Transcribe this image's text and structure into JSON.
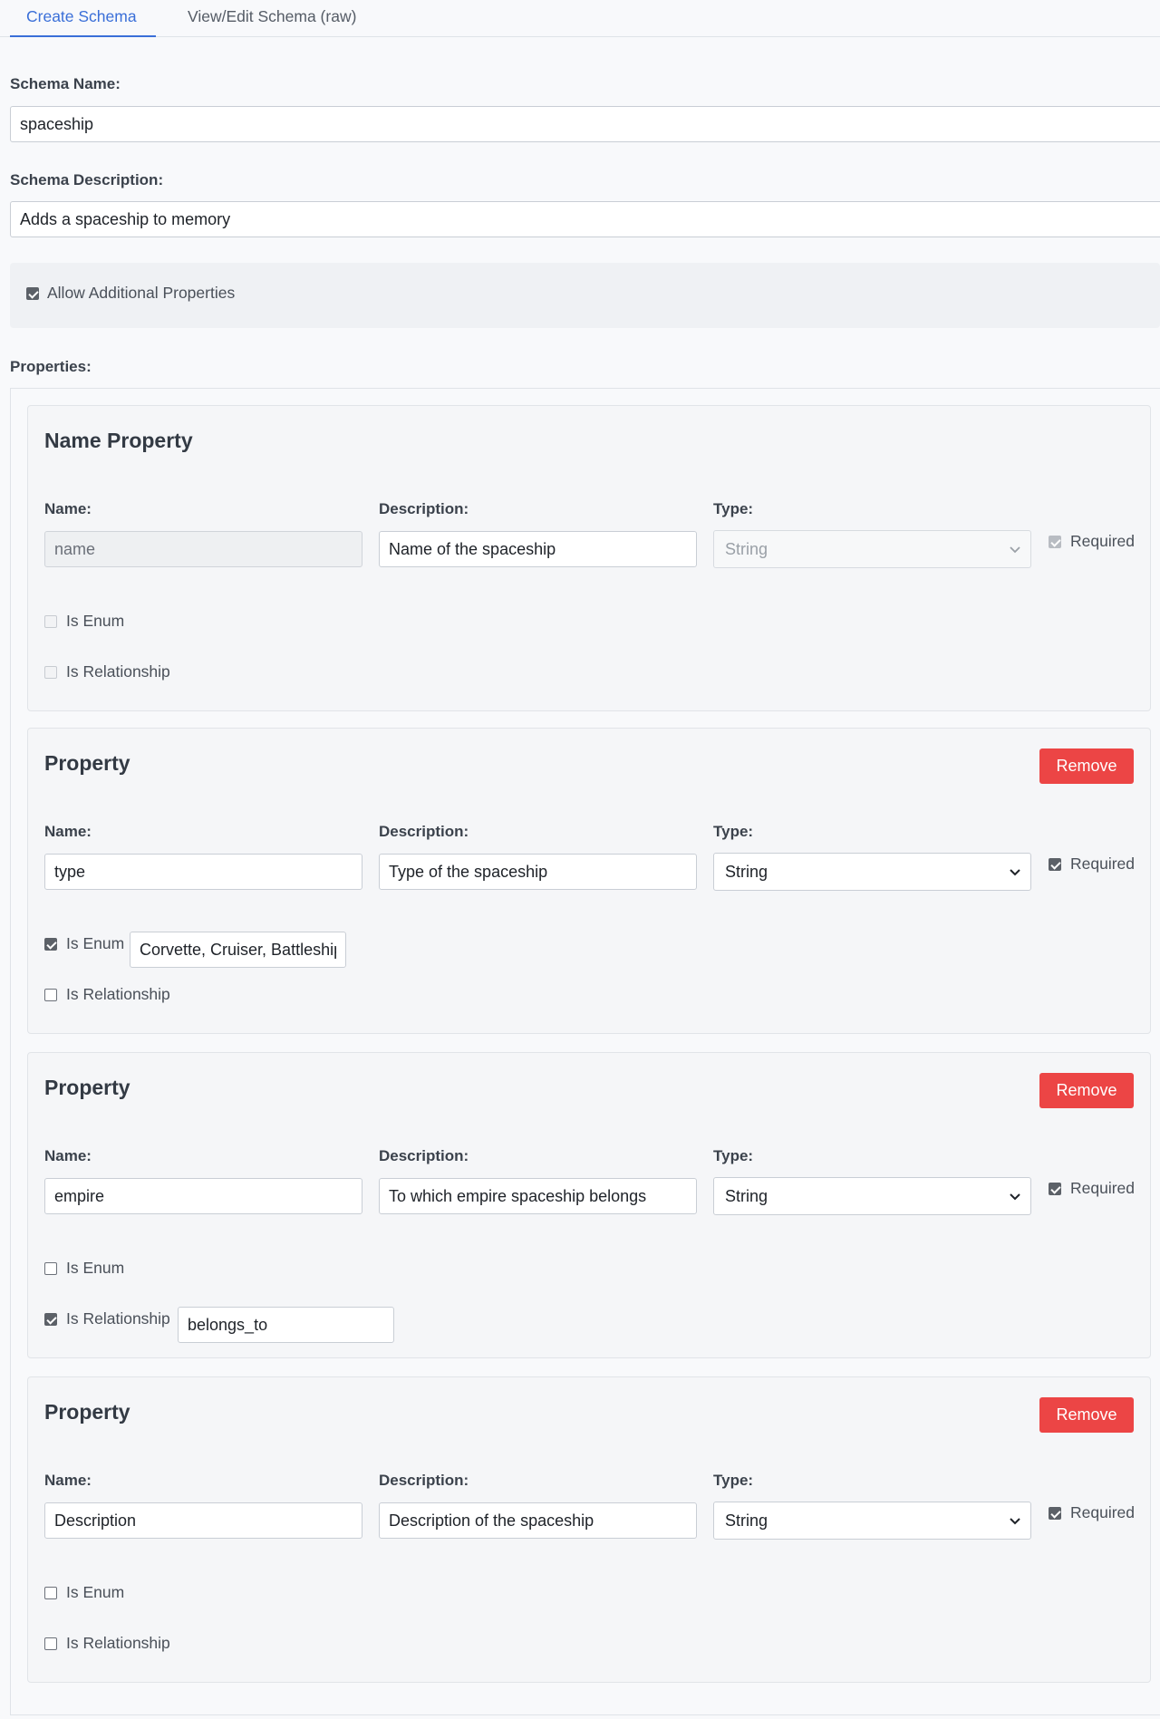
{
  "tabs": [
    {
      "label": "Create Schema",
      "active": true
    },
    {
      "label": "View/Edit Schema (raw)",
      "active": false
    }
  ],
  "schema_name": {
    "label": "Schema Name:",
    "value": "spaceship"
  },
  "schema_description": {
    "label": "Schema Description:",
    "value": "Adds a spaceship to memory"
  },
  "allow_additional": {
    "label": "Allow Additional Properties",
    "checked": true
  },
  "properties_label": "Properties:",
  "field_labels": {
    "name": "Name:",
    "description": "Description:",
    "type": "Type:",
    "required": "Required",
    "is_enum": "Is Enum",
    "is_relationship": "Is Relationship"
  },
  "remove_label": "Remove",
  "cards": [
    {
      "title": "Name Property",
      "name": "name",
      "description": "Name of the spaceship",
      "type": "String",
      "required": true,
      "is_enum": false,
      "enum_values": "",
      "is_relationship": false,
      "relationship": ""
    },
    {
      "title": "Property",
      "name": "type",
      "description": "Type of the spaceship",
      "type": "String",
      "required": true,
      "is_enum": true,
      "enum_values": "Corvette, Cruiser, Battleship",
      "is_relationship": false,
      "relationship": ""
    },
    {
      "title": "Property",
      "name": "empire",
      "description": "To which empire spaceship belongs",
      "type": "String",
      "required": true,
      "is_enum": false,
      "enum_values": "",
      "is_relationship": true,
      "relationship": "belongs_to"
    },
    {
      "title": "Property",
      "name": "Description",
      "description": "Description of the spaceship",
      "type": "String",
      "required": true,
      "is_enum": false,
      "enum_values": "",
      "is_relationship": false,
      "relationship": ""
    }
  ]
}
